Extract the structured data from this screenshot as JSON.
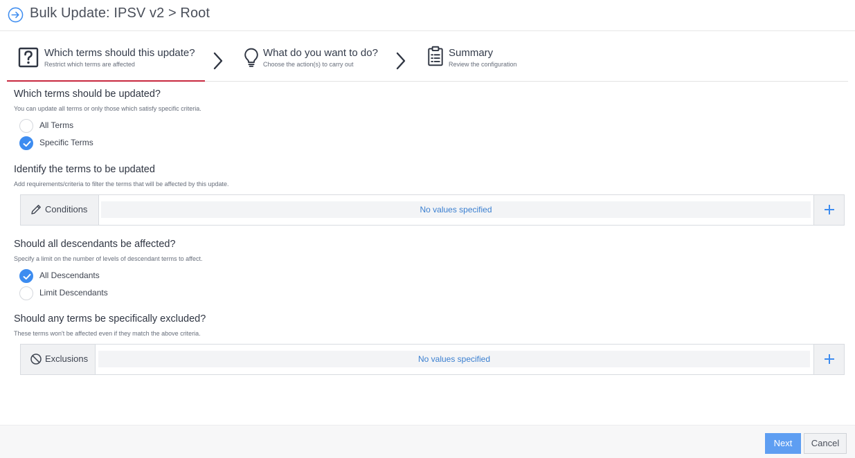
{
  "header": {
    "title": "Bulk Update: IPSV v2 > Root",
    "back_icon": "arrow-circle-right-icon"
  },
  "steps": [
    {
      "title": "Which terms should this update?",
      "subtitle": "Restrict which terms are affected",
      "icon": "question-box-icon",
      "active": true
    },
    {
      "title": "What do you want to do?",
      "subtitle": "Choose the action(s) to carry out",
      "icon": "lightbulb-icon",
      "active": false
    },
    {
      "title": "Summary",
      "subtitle": "Review the configuration",
      "icon": "clipboard-icon",
      "active": false
    }
  ],
  "sections": {
    "which_terms": {
      "title": "Which terms should be updated?",
      "description": "You can update all terms or only those which satisfy specific criteria.",
      "options": [
        {
          "label": "All Terms",
          "checked": false
        },
        {
          "label": "Specific Terms",
          "checked": true
        }
      ]
    },
    "identify": {
      "title": "Identify the terms to be updated",
      "description": "Add requirements/criteria to filter the terms that will be affected by this update.",
      "box_label": "Conditions",
      "box_value": "No values specified"
    },
    "descendants": {
      "title": "Should all descendants be affected?",
      "description": "Specify a limit on the number of levels of descendant terms to affect.",
      "options": [
        {
          "label": "All Descendants",
          "checked": true
        },
        {
          "label": "Limit Descendants",
          "checked": false
        }
      ]
    },
    "exclusions": {
      "title": "Should any terms be specifically excluded?",
      "description": "These terms won't be affected even if they match the above criteria.",
      "box_label": "Exclusions",
      "box_value": "No values specified"
    }
  },
  "footer": {
    "next_label": "Next",
    "cancel_label": "Cancel"
  },
  "colors": {
    "accent": "#3d8cf0",
    "active_step_underline": "#c8283f",
    "link_text": "#3a7fd0"
  }
}
